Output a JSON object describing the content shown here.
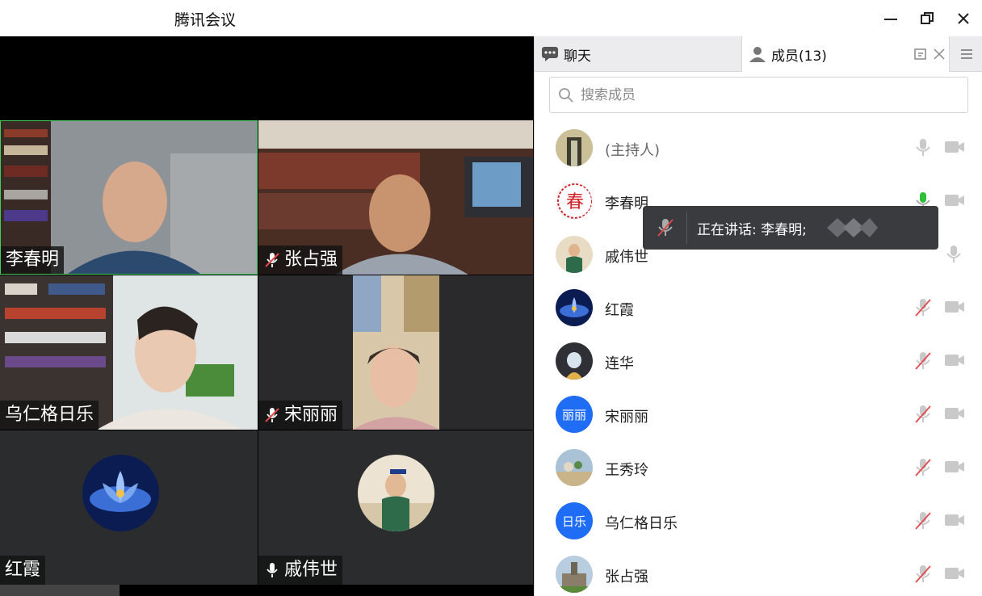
{
  "window": {
    "title": "腾讯会议"
  },
  "video": {
    "tiles": [
      {
        "name": "李春明",
        "muted": false,
        "show_mic": false
      },
      {
        "name": "张占强",
        "muted": true,
        "show_mic": true
      },
      {
        "name": "乌仁格日乐",
        "muted": false,
        "show_mic": false
      },
      {
        "name": "宋丽丽",
        "muted": true,
        "show_mic": true
      },
      {
        "name": "红霞",
        "muted": false,
        "show_mic": false
      },
      {
        "name": "戚伟世",
        "muted": false,
        "show_mic": true
      }
    ]
  },
  "panel": {
    "tab_chat": "聊天",
    "tab_members": "成员(13)",
    "search_placeholder": "搜索成员",
    "members": [
      {
        "name": "(主持人)",
        "mic": "off-grey",
        "avatar": "landscape"
      },
      {
        "name": "李春明",
        "mic": "speaking",
        "avatar": "chun-logo"
      },
      {
        "name": "戚伟世",
        "mic": "on",
        "avatar": "kid"
      },
      {
        "name": "红霞",
        "mic": "muted",
        "avatar": "lotus"
      },
      {
        "name": "连华",
        "mic": "muted",
        "avatar": "doll"
      },
      {
        "name": "宋丽丽",
        "mic": "muted",
        "avatar": "text",
        "avatar_text": "丽丽",
        "avatar_color": "#1f6cf5"
      },
      {
        "name": "王秀玲",
        "mic": "muted",
        "avatar": "flowers"
      },
      {
        "name": "乌仁格日乐",
        "mic": "muted",
        "avatar": "text",
        "avatar_text": "日乐",
        "avatar_color": "#1f6cf5"
      },
      {
        "name": "张占强",
        "mic": "muted",
        "avatar": "building"
      }
    ]
  },
  "toast": {
    "text": "正在讲话: 李春明;"
  },
  "colors": {
    "speaking": "#2fbf3a",
    "muted": "#e5484d",
    "accent": "#1f6cf5"
  }
}
